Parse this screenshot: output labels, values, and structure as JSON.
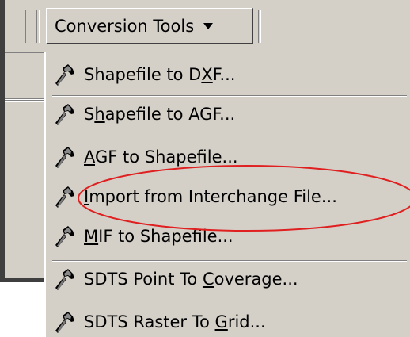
{
  "toolbar": {
    "dropdown_label": "Conversion Tools"
  },
  "menu": {
    "items": [
      {
        "pre": "Shapefile to D",
        "mn": "X",
        "post": "F...",
        "icon": "hammer-icon"
      },
      {
        "pre": "S",
        "mn": "h",
        "post": "apefile to AGF...",
        "icon": "hammer-icon"
      },
      {
        "pre": "",
        "mn": "A",
        "post": "GF to Shapefile...",
        "icon": "hammer-icon"
      },
      {
        "pre": "",
        "mn": "I",
        "post": "mport from Interchange File...",
        "icon": "hammer-icon"
      },
      {
        "pre": "",
        "mn": "M",
        "post": "IF to Shapefile...",
        "icon": "hammer-icon"
      },
      {
        "pre": "SDTS Point To ",
        "mn": "C",
        "post": "overage...",
        "icon": "hammer-icon"
      },
      {
        "pre": "SDTS Raster To ",
        "mn": "G",
        "post": "rid...",
        "icon": "hammer-icon"
      }
    ]
  },
  "colors": {
    "annotation": "#e02020",
    "menu_bg": "#d4d0c8"
  }
}
